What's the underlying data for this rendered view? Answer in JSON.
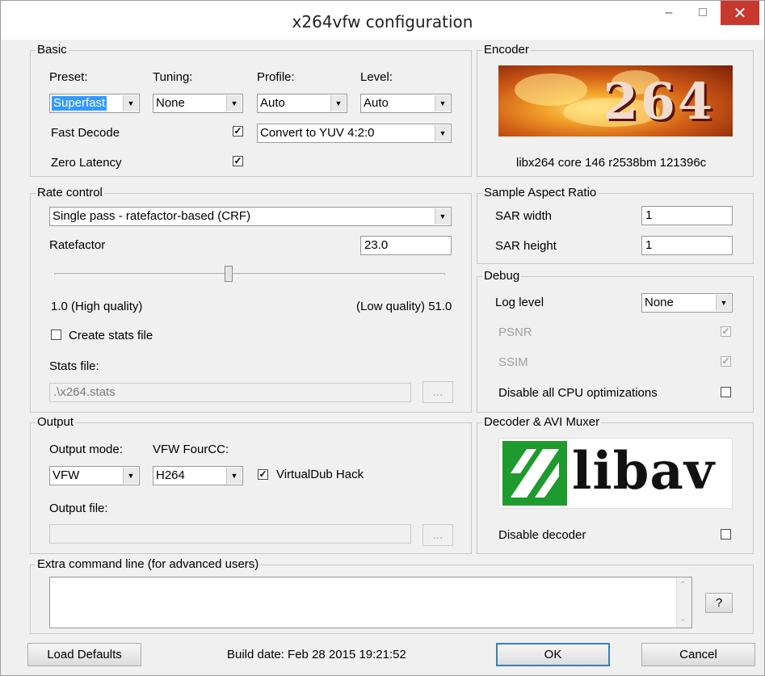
{
  "window": {
    "title": "x264vfw configuration"
  },
  "basic": {
    "title": "Basic",
    "preset_label": "Preset:",
    "preset_value": "Superfast",
    "tuning_label": "Tuning:",
    "tuning_value": "None",
    "profile_label": "Profile:",
    "profile_value": "Auto",
    "level_label": "Level:",
    "level_value": "Auto",
    "fast_decode_label": "Fast Decode",
    "fast_decode_checked": true,
    "zero_latency_label": "Zero Latency",
    "zero_latency_checked": true,
    "colorspace_value": "Convert to YUV 4:2:0"
  },
  "encoder": {
    "title": "Encoder",
    "logo_text": "264",
    "version": "libx264 core 146 r2538bm 121396c"
  },
  "rate_control": {
    "title": "Rate control",
    "mode_value": "Single pass - ratefactor-based (CRF)",
    "ratefactor_label": "Ratefactor",
    "ratefactor_value": "23.0",
    "slider_min": 1.0,
    "slider_max": 51.0,
    "slider_value": 23.0,
    "min_label": "1.0 (High quality)",
    "max_label": "(Low quality) 51.0",
    "create_stats_label": "Create stats file",
    "create_stats_checked": false,
    "stats_file_label": "Stats file:",
    "stats_file_value": ".\\x264.stats",
    "browse_label": "..."
  },
  "sar": {
    "title": "Sample Aspect Ratio",
    "width_label": "SAR width",
    "width_value": "1",
    "height_label": "SAR height",
    "height_value": "1"
  },
  "debug": {
    "title": "Debug",
    "log_level_label": "Log level",
    "log_level_value": "None",
    "psnr_label": "PSNR",
    "psnr_checked": true,
    "ssim_label": "SSIM",
    "ssim_checked": true,
    "disable_cpu_label": "Disable all CPU optimizations",
    "disable_cpu_checked": false
  },
  "output": {
    "title": "Output",
    "mode_label": "Output mode:",
    "mode_value": "VFW",
    "fourcc_label": "VFW FourCC:",
    "fourcc_value": "H264",
    "vdub_label": "VirtualDub Hack",
    "vdub_checked": true,
    "file_label": "Output file:",
    "file_value": "",
    "browse_label": "..."
  },
  "decoder": {
    "title": "Decoder & AVI Muxer",
    "logo_text": "libav",
    "disable_label": "Disable decoder",
    "disable_checked": false
  },
  "extra": {
    "title": "Extra command line (for advanced users)",
    "value": "",
    "help_label": "?"
  },
  "footer": {
    "load_defaults": "Load Defaults",
    "build_date": "Build date: Feb 28 2015 19:21:52",
    "ok": "OK",
    "cancel": "Cancel"
  },
  "colors": {
    "close_button": "#c7392f",
    "selection": "#3399ff",
    "libav_green": "#1f9a2e"
  }
}
